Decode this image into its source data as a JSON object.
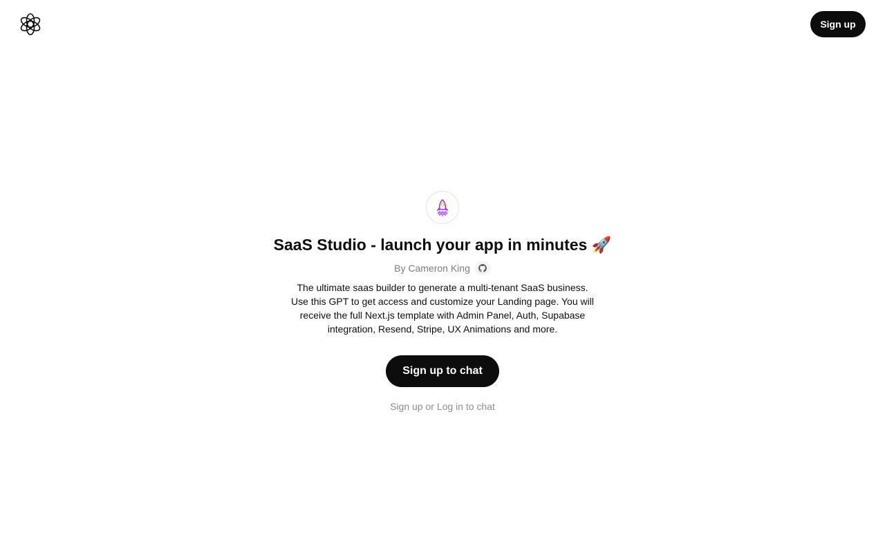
{
  "header": {
    "logo_icon": "openai-logo-icon",
    "signup_label": "Sign up"
  },
  "gpt": {
    "avatar_icon": "rocket-icon",
    "title": "SaaS Studio - launch your app in minutes 🚀",
    "author": "By Cameron King",
    "author_link_icon": "github-icon",
    "description": "The ultimate saas builder to generate a multi-tenant SaaS business. Use this GPT to get access and customize your Landing page. You will receive the full Next.js template with Admin Panel, Auth, Supabase integration, Resend, Stripe, UX Animations and more."
  },
  "cta": {
    "label": "Sign up to chat"
  },
  "login_prompt": {
    "signup_link": "Sign up",
    "or": "or",
    "login_link": "Log in",
    "suffix": "to chat"
  },
  "colors": {
    "primary_button": "#0d0d0d",
    "muted_text": "#8e8e8e",
    "accent_purple": "#9b30e8",
    "accent_yellow": "#f2c94c"
  }
}
